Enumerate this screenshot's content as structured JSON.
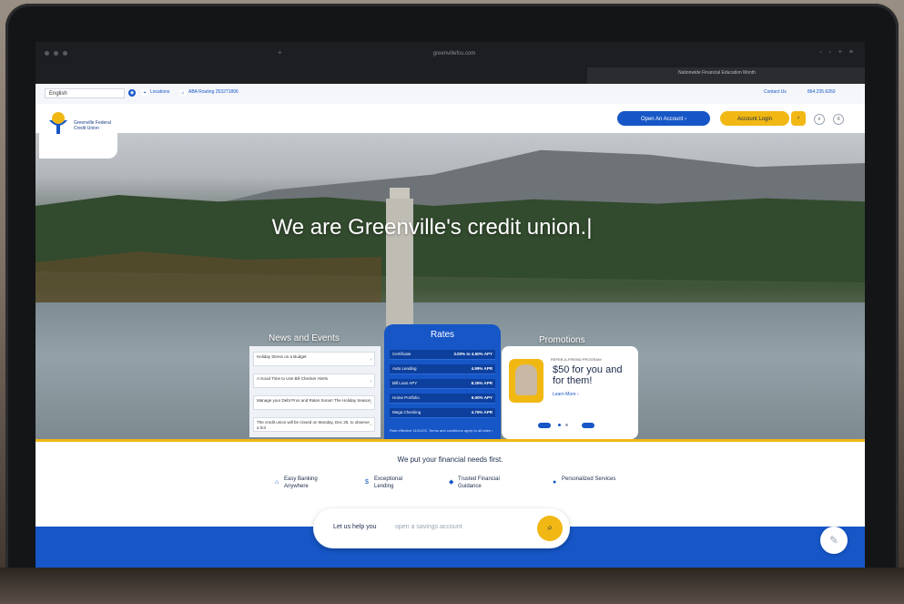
{
  "browser": {
    "url": "greenvillefcu.com",
    "banner": "Nationwide Financial Education Month",
    "controls": "◦ ◦ + ≡"
  },
  "utility": {
    "language": "English",
    "locations": "Locations",
    "routing": "ABA Routing 253271806",
    "contact": "Contact Us",
    "phone": "864.235.6260"
  },
  "header": {
    "logo_text": "Greenville Federal Credit Union",
    "open_account": "Open An Account  ›",
    "account_login": "Account Login",
    "login_chevron": "›",
    "search_icon": "⌕",
    "menu_icon": "≡"
  },
  "hero": {
    "title": "We are Greenville's credit union.|"
  },
  "news": {
    "heading": "News and Events",
    "items": [
      "Holiday Stress on a Budget",
      "A Good Time to Use Bill Checker Alerts",
      "Manage your Debt Pros and Rates Sonar! The Holiday Season",
      "The credit union will be closed on Monday, Dec 25, to observe a hol"
    ]
  },
  "rates": {
    "title": "Rates",
    "rows": [
      {
        "label": "Certificate",
        "value": "3.00% to 4.50% APY"
      },
      {
        "label": "Auto Lending",
        "value": "4.99% APR"
      },
      {
        "label": "Bill Loan APY",
        "value": "8.25% APR"
      },
      {
        "label": "Home Portfolio",
        "value": "6.00% APY"
      },
      {
        "label": "Mega Checking",
        "value": "4.75% APR"
      }
    ],
    "footer": "Rate effective 11/01/23. Terms and conditions apply to all rates ›"
  },
  "promotions": {
    "heading": "Promotions",
    "kicker": "REFER-A-FRIEND PROGRAM",
    "title": "$50 for you and for them!",
    "link": "Learn More  ›"
  },
  "features": {
    "tagline": "We put your financial needs first.",
    "items": [
      {
        "label": "Easy Banking Anywhere",
        "icon": "bank-icon"
      },
      {
        "label": "Exceptional Lending",
        "icon": "dollar-icon"
      },
      {
        "label": "Trusted Financial Guidance",
        "icon": "shield-icon"
      },
      {
        "label": "Personalized Services",
        "icon": "person-icon"
      }
    ]
  },
  "search": {
    "lead": "Let us help you",
    "placeholder": "open a savings account",
    "icon": "⌕"
  },
  "colors": {
    "brand_blue": "#1656c7",
    "brand_gold": "#f1b814",
    "navy": "#1a2a4a"
  }
}
